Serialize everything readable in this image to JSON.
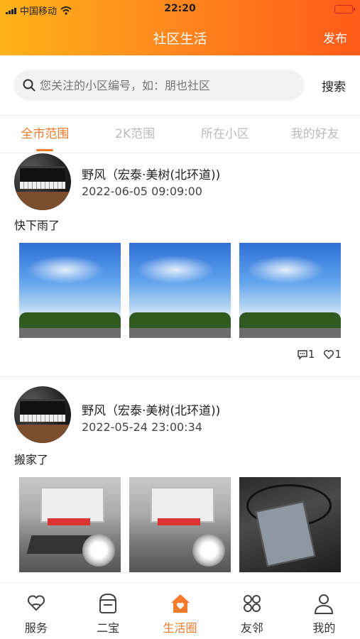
{
  "status": {
    "carrier": "中国移动",
    "time": "22:20"
  },
  "header": {
    "title": "社区生活",
    "publish": "发布"
  },
  "search": {
    "placeholder": "您关注的小区编号，如：朋也社区",
    "button": "搜索"
  },
  "tabs": [
    {
      "label": "全市范围",
      "active": true
    },
    {
      "label": "2K范围"
    },
    {
      "label": "所在小区"
    },
    {
      "label": "我的好友"
    }
  ],
  "posts": [
    {
      "name": "野风（宏泰·美树(北环道))",
      "date": "2022-06-05 09:09:00",
      "content": "快下雨了",
      "comments": "1",
      "likes": "1"
    },
    {
      "name": "野风（宏泰·美树(北环道))",
      "date": "2022-05-24 23:00:34",
      "content": "搬家了"
    }
  ],
  "tabbar": [
    {
      "label": "服务",
      "icon": "handshake-heart-icon"
    },
    {
      "label": "二宝",
      "icon": "bag-icon"
    },
    {
      "label": "生活圈",
      "icon": "home-icon",
      "active": true
    },
    {
      "label": "友邻",
      "icon": "grid-icon"
    },
    {
      "label": "我的",
      "icon": "user-icon"
    }
  ],
  "colors": {
    "accent": "#f47a2b",
    "header_start": "#ffb319",
    "header_end": "#ff5a1a"
  }
}
